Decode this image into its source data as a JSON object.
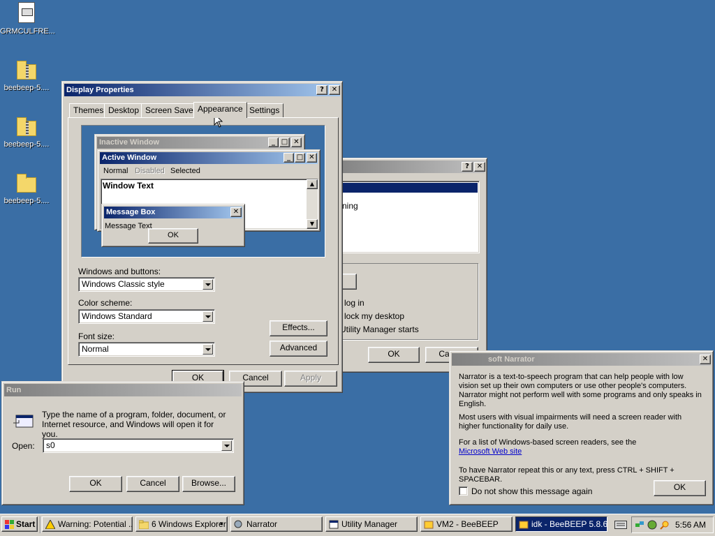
{
  "desktop": {
    "icons": [
      {
        "label": "GRMCULFRE...",
        "icon": "document-icon"
      },
      {
        "label": "beebeep-5....",
        "icon": "zip-folder-icon"
      },
      {
        "label": "beebeep-5....",
        "icon": "zip-folder-icon"
      },
      {
        "label": "beebeep-5....",
        "icon": "folder-icon"
      }
    ]
  },
  "display_properties": {
    "title": "Display Properties",
    "tabs": [
      "Themes",
      "Desktop",
      "Screen Saver",
      "Appearance",
      "Settings"
    ],
    "active_tab": "Appearance",
    "preview": {
      "inactive_title": "Inactive Window",
      "active_title": "Active Window",
      "menu": [
        "Normal",
        "Disabled",
        "Selected"
      ],
      "window_text": "Window Text",
      "msgbox_title": "Message Box",
      "msgbox_text": "Message Text",
      "msgbox_ok": "OK"
    },
    "windows_buttons_label": "Windows and buttons:",
    "windows_buttons_value": "Windows Classic style",
    "color_scheme_label": "Color scheme:",
    "color_scheme_value": "Windows Standard",
    "font_size_label": "Font size:",
    "font_size_value": "Normal",
    "effects_button": "Effects...",
    "advanced_button": "Advanced",
    "ok": "OK",
    "cancel": "Cancel",
    "apply": "Apply"
  },
  "utility_manager": {
    "list_item": "ning",
    "option1": "log in",
    "option2": "lock my desktop",
    "option3": "Utility Manager starts",
    "ok": "OK",
    "cancel": "Cancel"
  },
  "run": {
    "title": "Run",
    "description": "Type the name of a program, folder, document, or Internet resource, and Windows will open it for you.",
    "open_label": "Open:",
    "open_value": "s0",
    "ok": "OK",
    "cancel": "Cancel",
    "browse": "Browse..."
  },
  "narrator": {
    "title": "soft Narrator",
    "p1": "Narrator is a text-to-speech program that can help people with low vision set up their own computers or use other people's computers. Narrator might not perform well with some programs and only speaks in English.",
    "p2": "Most users with visual impairments will need a screen reader with higher functionality for daily use.",
    "p3": "For a list of Windows-based screen readers, see the",
    "link": "Microsoft Web site",
    "p4": "To have Narrator repeat this or any text, press CTRL + SHIFT + SPACEBAR.",
    "checkbox_label": "Do not show this message again",
    "ok": "OK"
  },
  "taskbar": {
    "start": "Start",
    "buttons": [
      {
        "label": "Warning: Potential ...",
        "icon": "warning-icon"
      },
      {
        "label": "6 Windows Explorer",
        "icon": "folder-icon"
      },
      {
        "label": "Narrator",
        "icon": "narrator-icon"
      },
      {
        "label": "Utility Manager",
        "icon": "utility-manager-icon"
      },
      {
        "label": "VM2 - BeeBEEP",
        "icon": "beebeep-icon"
      },
      {
        "label": "idk - BeeBEEP 5.8.6",
        "icon": "beebeep-icon"
      }
    ],
    "clock": "5:56 AM"
  },
  "colors": {
    "desktop": "#3a6ea5",
    "title_active": "#0a246a",
    "title_active_end": "#a6caf0",
    "face": "#d4d0c8"
  }
}
